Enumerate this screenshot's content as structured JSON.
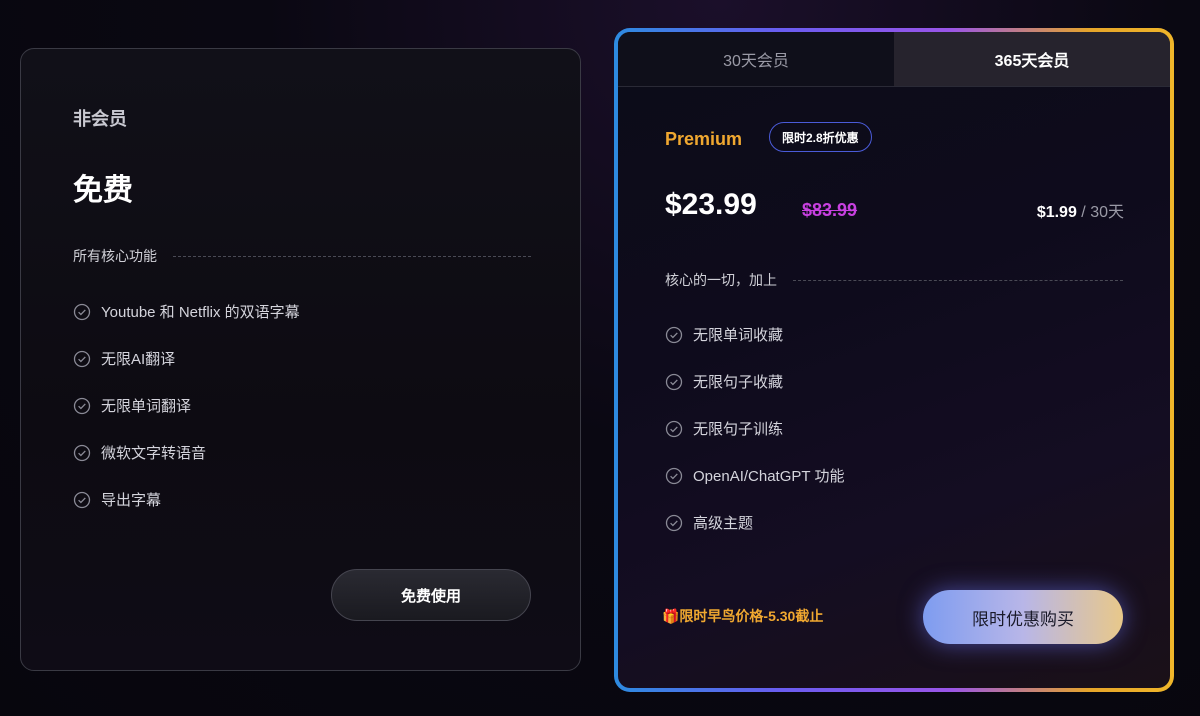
{
  "free": {
    "name": "非会员",
    "price": "免费",
    "section_title": "所有核心功能",
    "features": [
      "Youtube 和 Netflix 的双语字幕",
      "无限AI翻译",
      "无限单词翻译",
      "微软文字转语音",
      "导出字幕"
    ],
    "button": "免费使用"
  },
  "premium": {
    "tabs": [
      "30天会员",
      "365天会员"
    ],
    "active_tab": "365天会员",
    "plan_name": "Premium",
    "badge": "限时2.8折优惠",
    "price": "$23.99",
    "original_price": "$83.99",
    "monthly_amount": "$1.99",
    "monthly_period": " / 30天",
    "section_title": "核心的一切，加上",
    "features": [
      "无限单词收藏",
      "无限句子收藏",
      "无限句子训练",
      "OpenAI/ChatGPT 功能",
      "高级主题"
    ],
    "promo": "🎁限时早鸟价格-5.30截止",
    "button": "限时优惠购买"
  },
  "colors": {
    "accent_gold": "#f0a830",
    "accent_strike": "#c840e0",
    "badge_border": "#4a5bd8"
  },
  "icons": {
    "feature_check": "check-circle-icon"
  }
}
